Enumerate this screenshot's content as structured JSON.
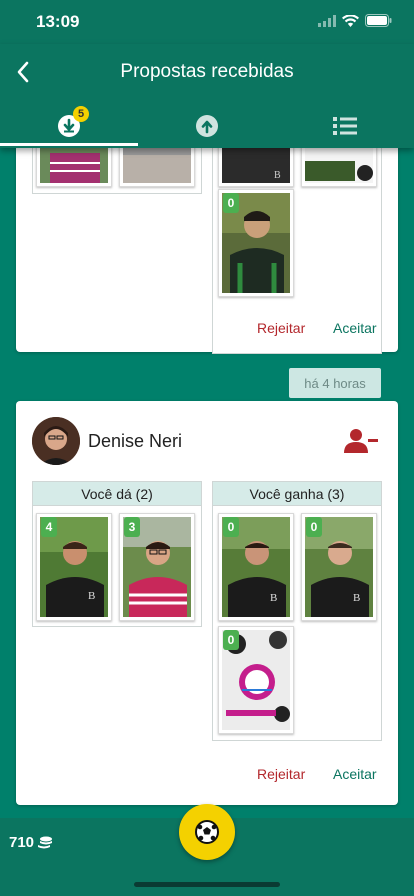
{
  "status": {
    "time": "13:09"
  },
  "header": {
    "title": "Propostas recebidas",
    "received_badge": "5"
  },
  "tabs": [
    {
      "icon": "download-icon",
      "active": true
    },
    {
      "icon": "upload-icon",
      "active": false
    },
    {
      "icon": "list-icon",
      "active": false
    }
  ],
  "proposal1": {
    "received": [
      {
        "count": "0"
      }
    ],
    "reject_label": "Rejeitar",
    "accept_label": "Aceitar"
  },
  "proposal2": {
    "time_ago": "há 4 horas",
    "user_name": "Denise Neri",
    "give_header": "Você dá (2)",
    "get_header": "Você ganha (3)",
    "give": [
      {
        "count": "4"
      },
      {
        "count": "3"
      }
    ],
    "get": [
      {
        "count": "0"
      },
      {
        "count": "0"
      },
      {
        "count": "0"
      }
    ],
    "reject_label": "Rejeitar",
    "accept_label": "Aceitar"
  },
  "footer": {
    "coins": "710"
  },
  "colors": {
    "primary": "#0b7560",
    "background": "#00806b",
    "accent": "#f4d100",
    "reject": "#b3272c",
    "count_badge": "#4caf50"
  }
}
